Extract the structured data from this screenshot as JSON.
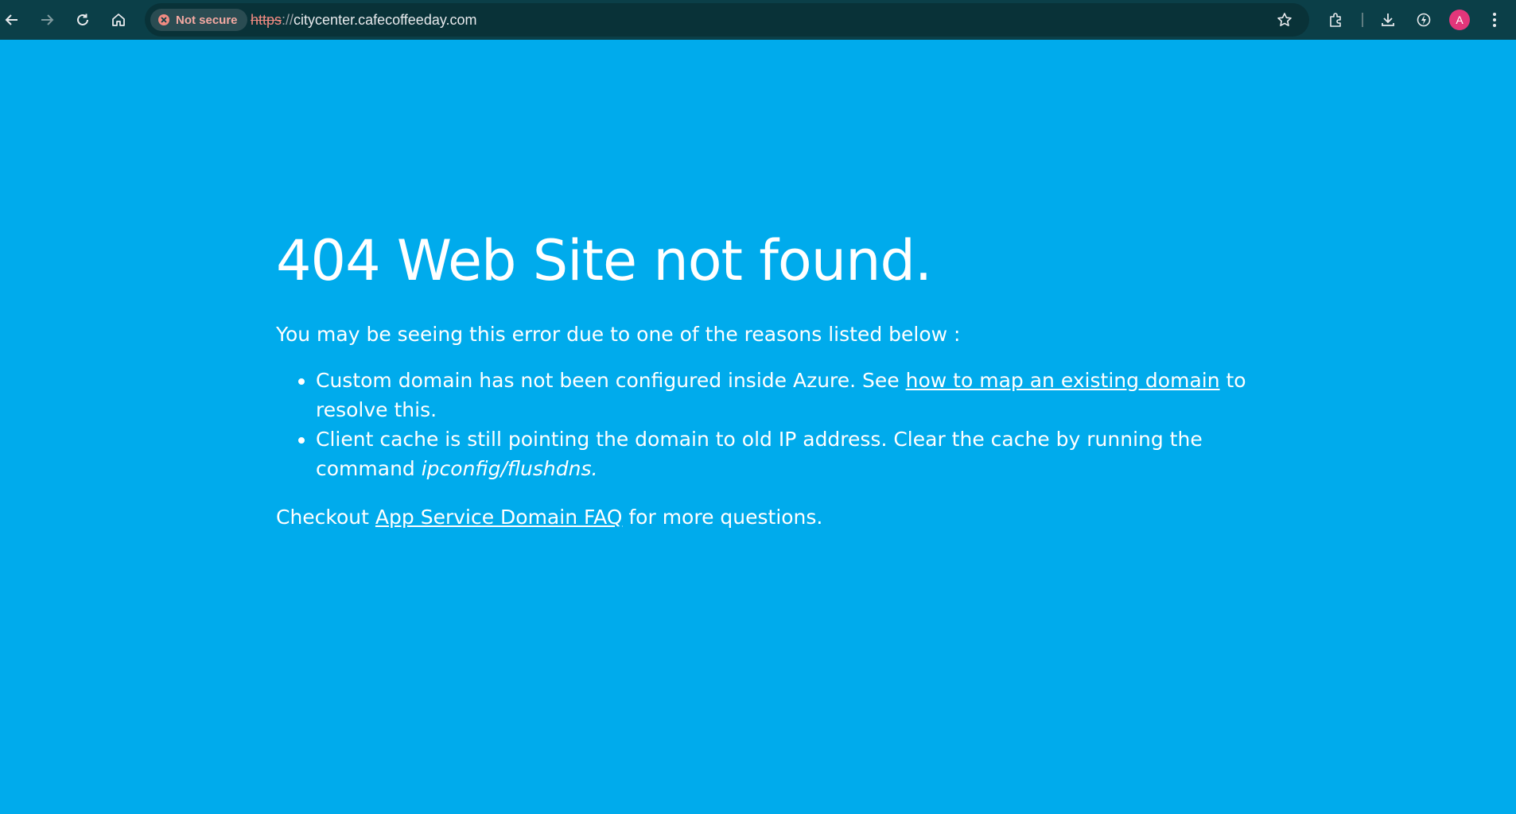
{
  "browser": {
    "security_label": "Not secure",
    "url_scheme": "https",
    "url_separator": "://",
    "url_host": "citycenter.cafecoffeeday.com",
    "avatar_letter": "A",
    "icons": [
      "back-icon",
      "forward-icon",
      "reload-icon",
      "home-icon",
      "star-icon",
      "extensions-icon",
      "download-icon",
      "performance-icon",
      "menu-icon"
    ]
  },
  "page": {
    "title": "404 Web Site not found.",
    "intro": "You may be seeing this error due to one of the reasons listed below :",
    "reason1_pre": "Custom domain has not been configured inside Azure. See ",
    "reason1_link": "how to map an existing domain",
    "reason1_post": " to resolve this.",
    "reason2_pre": "Client cache is still pointing the domain to old IP address. Clear the cache by running the command ",
    "reason2_cmd": "ipconfig/flushdns.",
    "faq_pre": "Checkout ",
    "faq_link": "App Service Domain FAQ",
    "faq_post": " for more questions."
  },
  "colors": {
    "page_background": "#00abec",
    "toolbar_background": "#0b3f48",
    "text": "#ffffff",
    "warning": "#f28b82",
    "avatar": "#e3367a"
  }
}
